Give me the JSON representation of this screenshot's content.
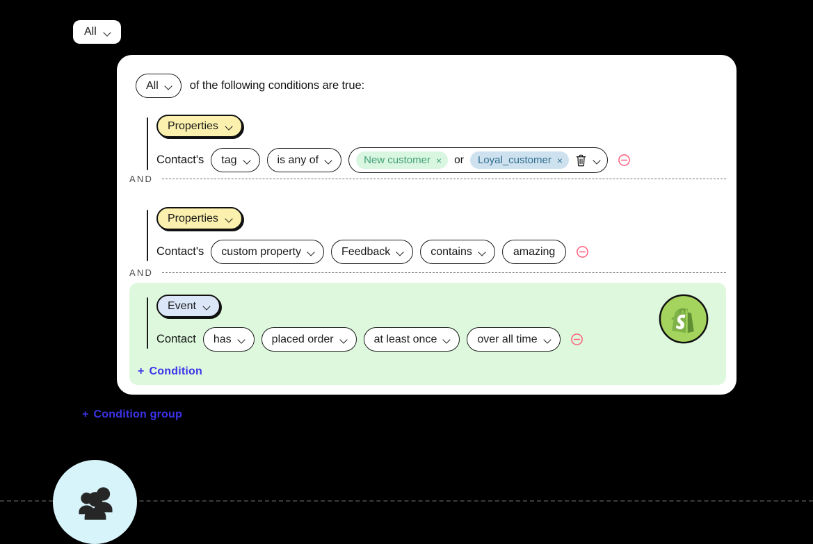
{
  "top_pill": {
    "label": "All",
    "icon": "chevron-down-icon"
  },
  "card": {
    "header": {
      "selector_label": "All",
      "text": "of the following conditions are true:"
    },
    "conditions": [
      {
        "id": "condition-1",
        "badge": {
          "label": "Properties",
          "type": "properties"
        },
        "subject": "Contact's",
        "fields": [
          {
            "name": "property-select",
            "label": "tag",
            "type": "select"
          },
          {
            "name": "operator-select",
            "label": "is any of",
            "type": "select"
          }
        ],
        "tag_box": {
          "tags": [
            {
              "label": "New customer",
              "color": "green",
              "remove": "×"
            },
            {
              "label": "Loyal_customer",
              "color": "blue",
              "remove": "×"
            }
          ],
          "joiner": "or",
          "trash_icon": "trash-icon",
          "chevron_icon": "chevron-down-icon"
        },
        "remove_icon": "remove-condition-icon"
      },
      {
        "id": "condition-2",
        "badge": {
          "label": "Properties",
          "type": "properties"
        },
        "subject": "Contact's",
        "fields": [
          {
            "name": "property-select",
            "label": "custom property",
            "type": "select"
          },
          {
            "name": "custom-property-select",
            "label": "Feedback",
            "type": "select"
          },
          {
            "name": "operator-select",
            "label": "contains",
            "type": "select"
          },
          {
            "name": "value-input",
            "label": "amazing",
            "type": "text"
          }
        ],
        "remove_icon": "remove-condition-icon"
      },
      {
        "id": "condition-3",
        "badge": {
          "label": "Event",
          "type": "event"
        },
        "subject": "Contact",
        "fields": [
          {
            "name": "verb-select",
            "label": "has",
            "type": "select"
          },
          {
            "name": "event-select",
            "label": "placed order",
            "type": "select"
          },
          {
            "name": "frequency-select",
            "label": "at least once",
            "type": "select"
          },
          {
            "name": "timeframe-select",
            "label": "over all time",
            "type": "select"
          }
        ],
        "remove_icon": "remove-condition-icon",
        "integration_icon": "shopify-icon"
      }
    ],
    "separators": [
      {
        "label": "AND"
      },
      {
        "label": "AND"
      }
    ],
    "add_condition": {
      "plus": "+",
      "label": "Condition"
    }
  },
  "add_condition_group": {
    "plus": "+",
    "label": "Condition group"
  },
  "audience_avatar": {
    "icon": "people-group-icon"
  },
  "colors": {
    "background": "#000000",
    "card": "#ffffff",
    "properties_badge": "#fbf0ad",
    "event_badge": "#dbe7f8",
    "event_panel": "#ddf8dd",
    "tag_green_bg": "#d9f6e1",
    "tag_green_text": "#3f9f76",
    "tag_blue_bg": "#cee1ef",
    "tag_blue_text": "#2f6d8f",
    "link": "#3b34e8",
    "remove": "#ff5c7a",
    "shopify": "#a5d45e",
    "avatar_bg": "#d7f4fb"
  }
}
